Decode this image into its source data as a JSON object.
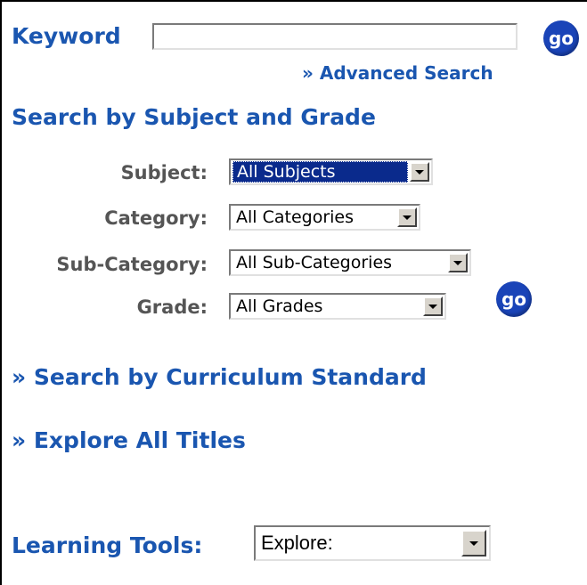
{
  "keyword": {
    "label": "Keyword",
    "value": "",
    "go_label": "go",
    "advanced_search": "» Advanced Search"
  },
  "subject_grade": {
    "title": "Search by Subject and Grade",
    "fields": [
      {
        "label": "Subject:",
        "value": "All Subjects"
      },
      {
        "label": "Category:",
        "value": "All Categories"
      },
      {
        "label": "Sub-Category:",
        "value": "All Sub-Categories"
      },
      {
        "label": "Grade:",
        "value": "All Grades"
      }
    ],
    "go_label": "go"
  },
  "links": {
    "curriculum": "» Search by Curriculum Standard",
    "explore": "» Explore All Titles"
  },
  "learning_tools": {
    "label": "Learning Tools:",
    "value": "Explore:"
  },
  "colors": {
    "accent": "#1a56b0",
    "button": "#1a44b8"
  }
}
